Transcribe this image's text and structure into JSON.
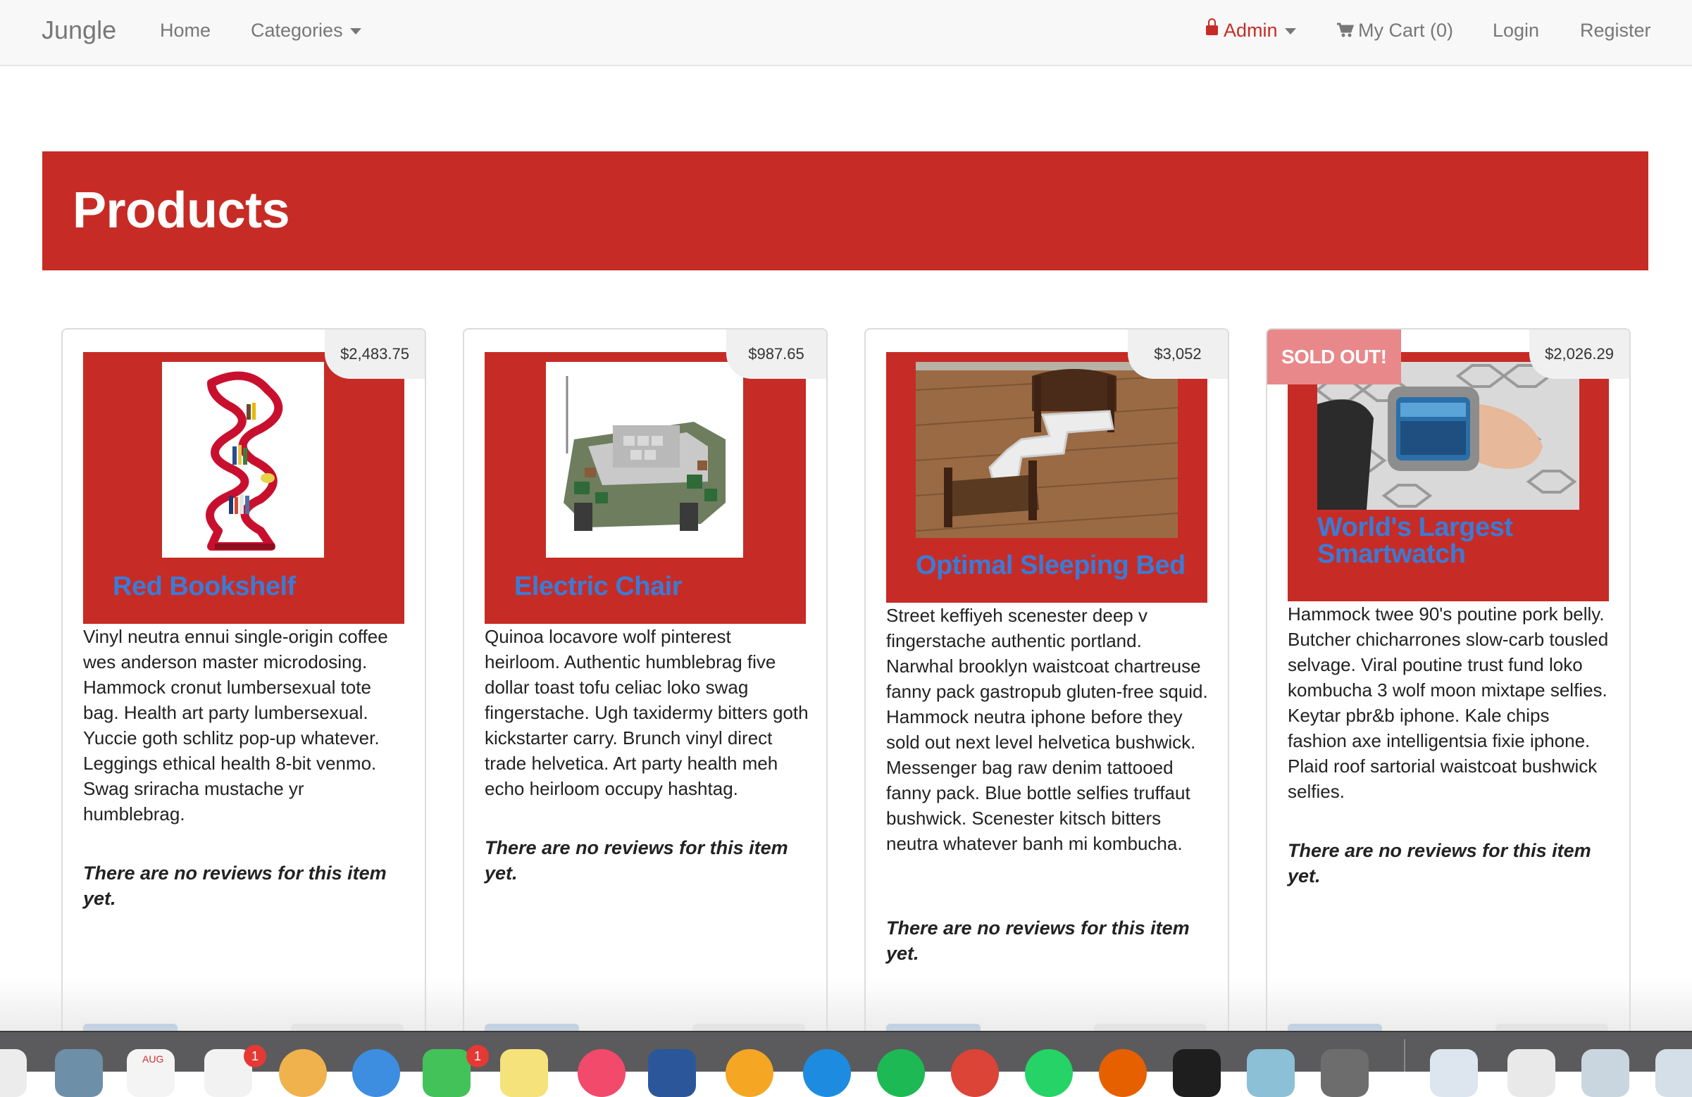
{
  "navbar": {
    "brand": "Jungle",
    "home": "Home",
    "categories": "Categories",
    "admin": "Admin",
    "cart": "My Cart (0)",
    "login": "Login",
    "register": "Register"
  },
  "page_title": "Products",
  "products": [
    {
      "name": "Red Bookshelf",
      "price": "$2,483.75",
      "description": "Vinyl neutra ennui single-origin coffee wes anderson master microdosing. Hammock cronut lumbersexual tote bag. Health art party lumbersexual. Yuccie goth schlitz pop-up whatever. Leggings ethical health 8-bit venmo. Swag sriracha mustache yr humblebrag.",
      "reviews_text": "There are no reviews for this item yet.",
      "sold_out": false
    },
    {
      "name": "Electric Chair",
      "price": "$987.65",
      "description": "Quinoa locavore wolf pinterest heirloom. Authentic humblebrag five dollar toast tofu celiac loko swag fingerstache. Ugh taxidermy bitters goth kickstarter carry. Brunch vinyl direct trade helvetica. Art party health meh echo heirloom occupy hashtag.",
      "reviews_text": "There are no reviews for this item yet.",
      "sold_out": false
    },
    {
      "name": "Optimal Sleeping Bed",
      "price": "$3,052",
      "description": "Street keffiyeh scenester deep v fingerstache authentic portland. Narwhal brooklyn waistcoat chartreuse fanny pack gastropub gluten-free squid. Hammock neutra iphone before they sold out next level helvetica bushwick. Messenger bag raw denim tattooed fanny pack. Blue bottle selfies truffaut bushwick. Scenester kitsch bitters neutra whatever banh mi kombucha.",
      "reviews_text": "There are no reviews for this item yet.",
      "sold_out": false
    },
    {
      "name": "World's Largest Smartwatch",
      "price": "$2,026.29",
      "description": "Hammock twee 90's poutine pork belly. Butcher chicharrones slow-carb tousled selvage. Viral poutine trust fund loko kombucha 3 wolf moon mixtape selfies. Keytar pbr&b iphone. Kale chips fashion axe intelligentsia fixie iphone. Plaid roof sartorial waistcoat bushwick selfies.",
      "reviews_text": "There are no reviews for this item yet.",
      "sold_out": true,
      "sold_out_label": "SOLD OUT!"
    }
  ],
  "dock": {
    "calendar_month": "AUG",
    "badges": [
      "1",
      "1"
    ]
  },
  "colors": {
    "accent_red": "#c62c25",
    "link_blue": "#3b7bd6",
    "sold_out_pink": "#e9888a"
  }
}
